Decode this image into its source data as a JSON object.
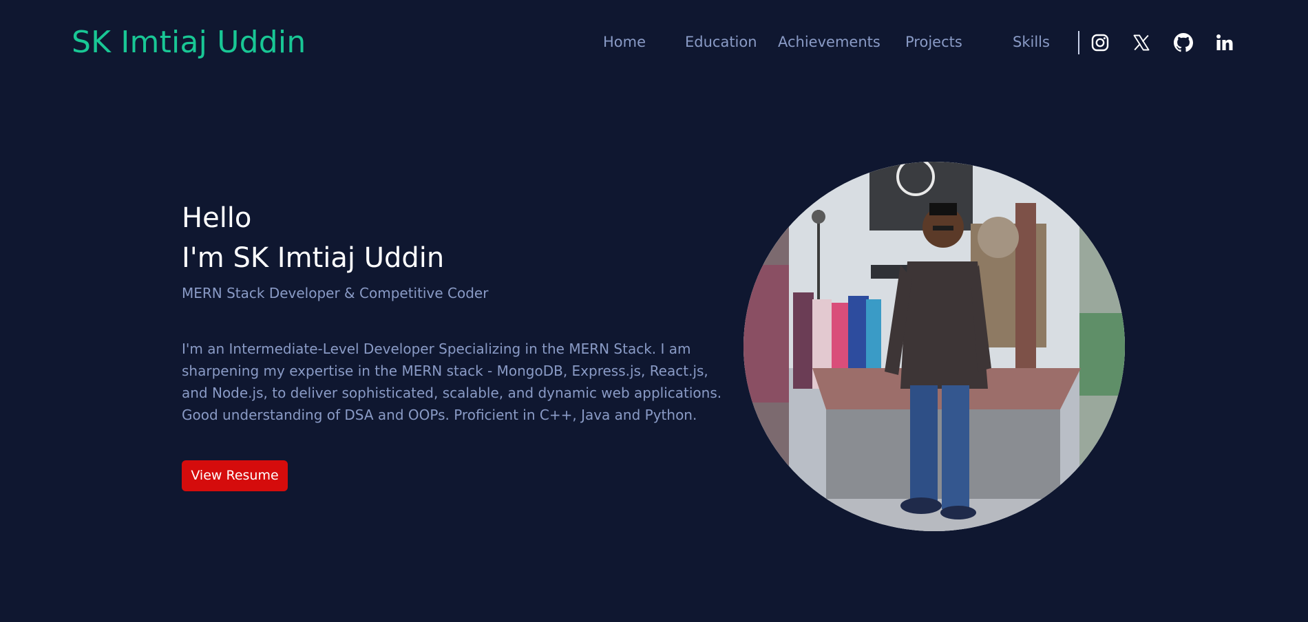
{
  "header": {
    "brand": "SK Imtiaj Uddin",
    "nav": [
      {
        "label": "Home"
      },
      {
        "label": "Education"
      },
      {
        "label": "Achievements"
      },
      {
        "label": "Projects"
      },
      {
        "label": "Skills"
      }
    ],
    "social_icons": [
      "instagram-icon",
      "x-twitter-icon",
      "github-icon",
      "linkedin-icon"
    ]
  },
  "hero": {
    "greeting": "Hello",
    "name_line": "I'm SK Imtiaj Uddin",
    "tagline": "MERN Stack Developer & Competitive Coder",
    "bio": "I'm an Intermediate-Level Developer Specializing in the MERN Stack. I am sharpening my expertise in the MERN stack - MongoDB, Express.js, React.js, and Node.js, to deliver sophisticated, scalable, and dynamic web applications. Good understanding of DSA and OOPs. Proficient in C++, Java and Python.",
    "resume_button": "View Resume"
  },
  "colors": {
    "background": "#0f1730",
    "brand": "#19c795",
    "nav_text": "#8a9bc6",
    "heading_text": "#ffffff",
    "button": "#d50c0c"
  }
}
